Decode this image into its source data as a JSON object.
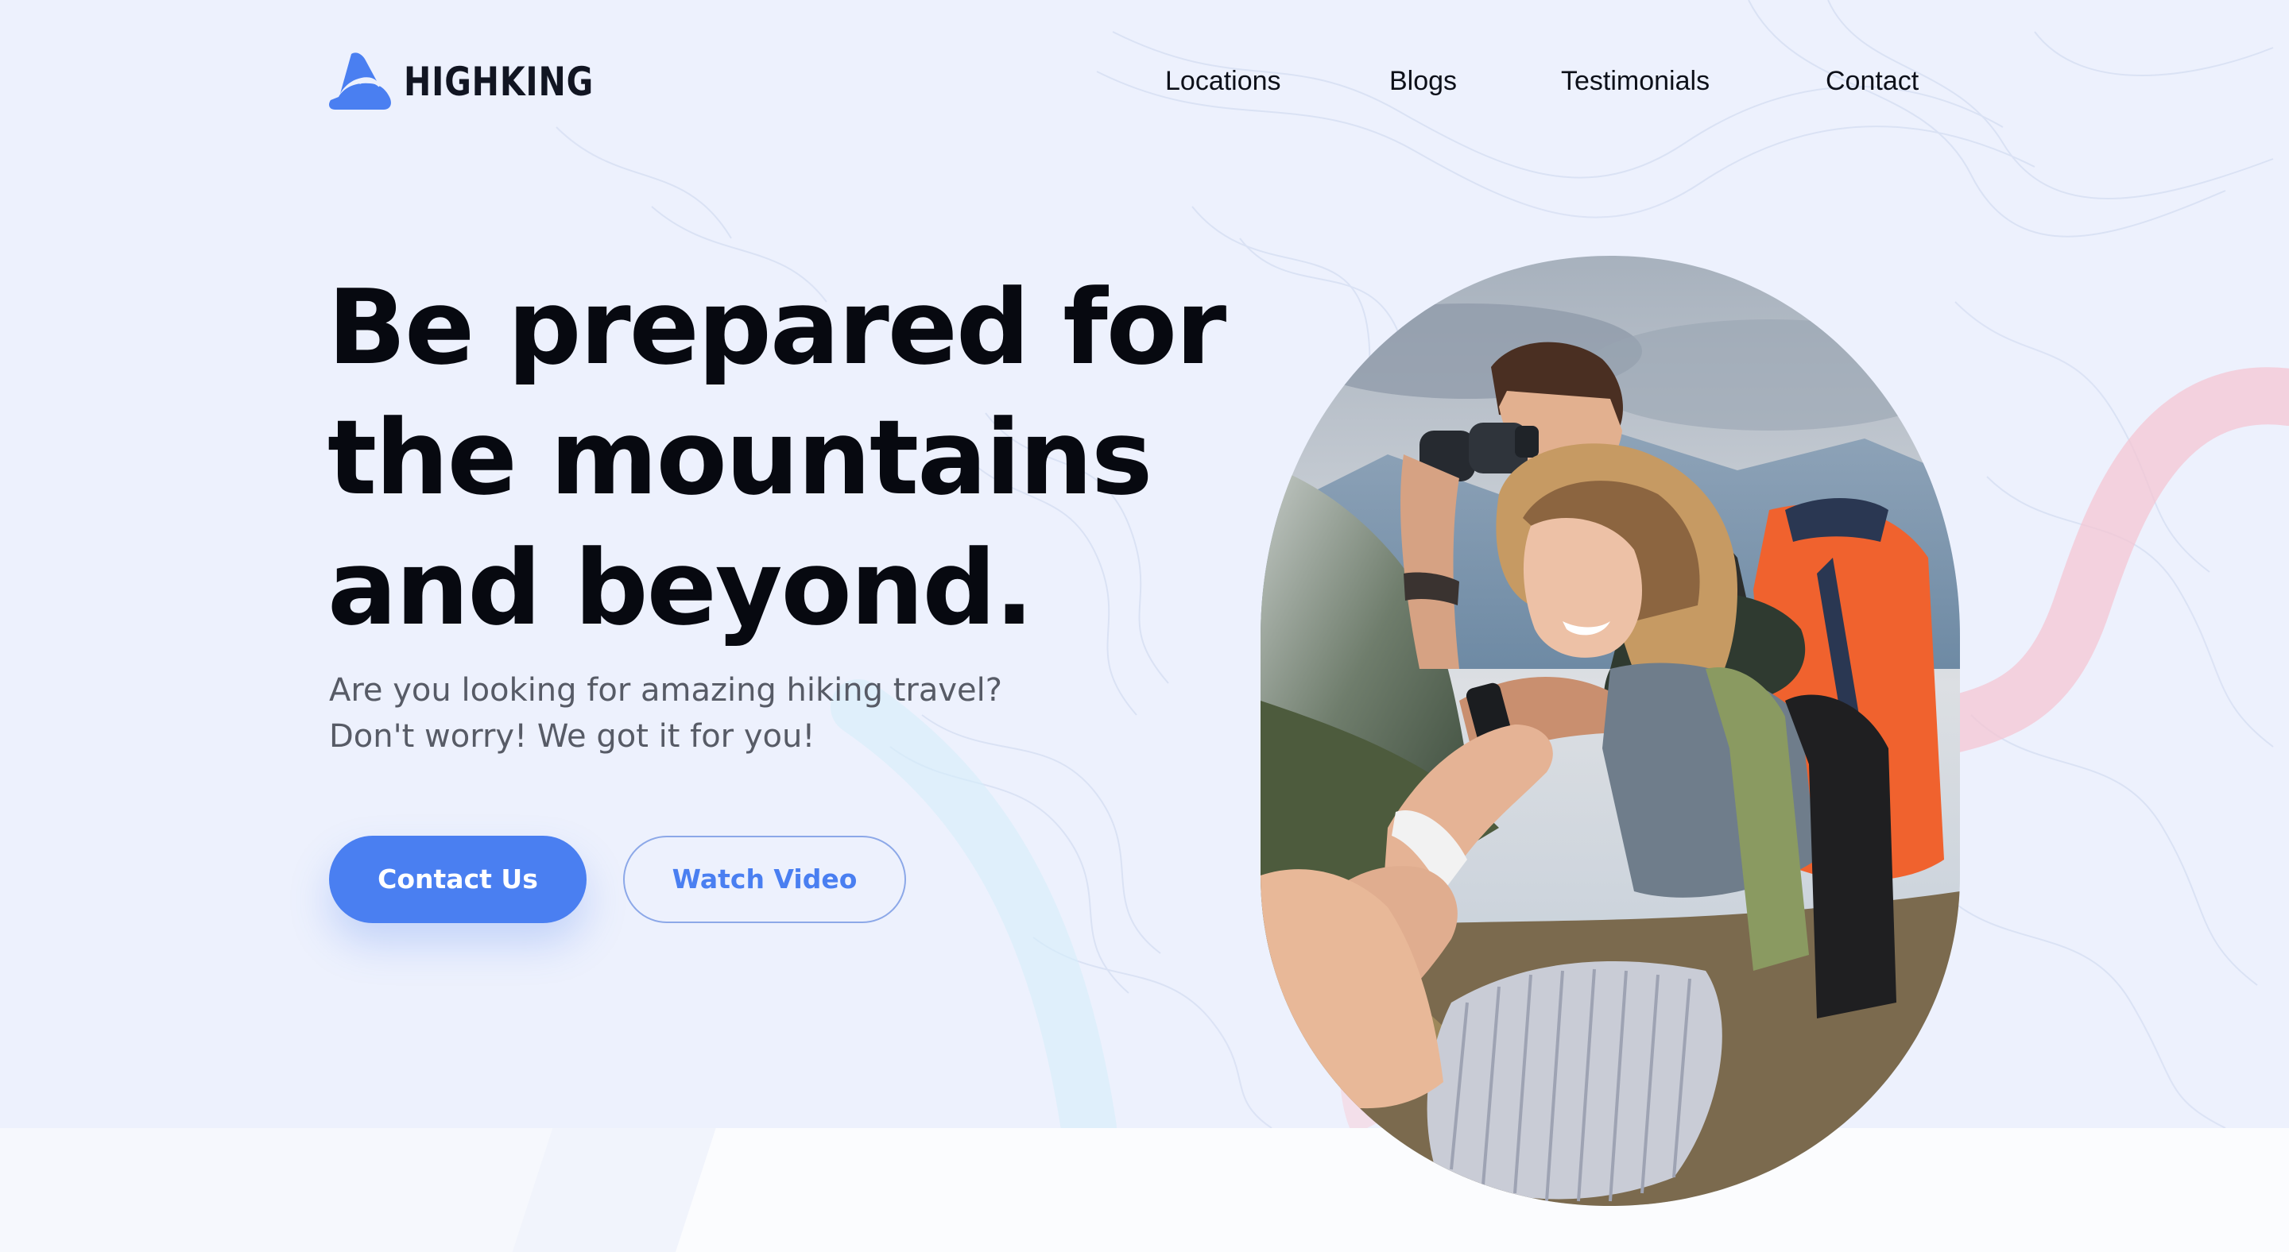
{
  "brand": {
    "name": "HIGHKING",
    "logo_icon": "mountain-logo-icon",
    "accent_color": "#4a7ff1"
  },
  "nav": {
    "items": [
      {
        "label": "Locations"
      },
      {
        "label": "Blogs"
      },
      {
        "label": "Testimonials"
      },
      {
        "label": "Contact"
      }
    ]
  },
  "hero": {
    "title_lines": [
      "Be prepared for",
      "the mountains",
      "and beyond."
    ],
    "subtitle_lines": [
      "Are you looking for amazing hiking travel?",
      "Don't worry! We got it for you!"
    ],
    "primary_cta": "Contact Us",
    "secondary_cta": "Watch Video"
  },
  "image": {
    "icon": "hikers-photo"
  },
  "colors": {
    "background": "#edf1fd",
    "primary_button": "#4a7ff1",
    "decor_pink": "#f4c6d3",
    "decor_cyan": "#d4eefa"
  }
}
